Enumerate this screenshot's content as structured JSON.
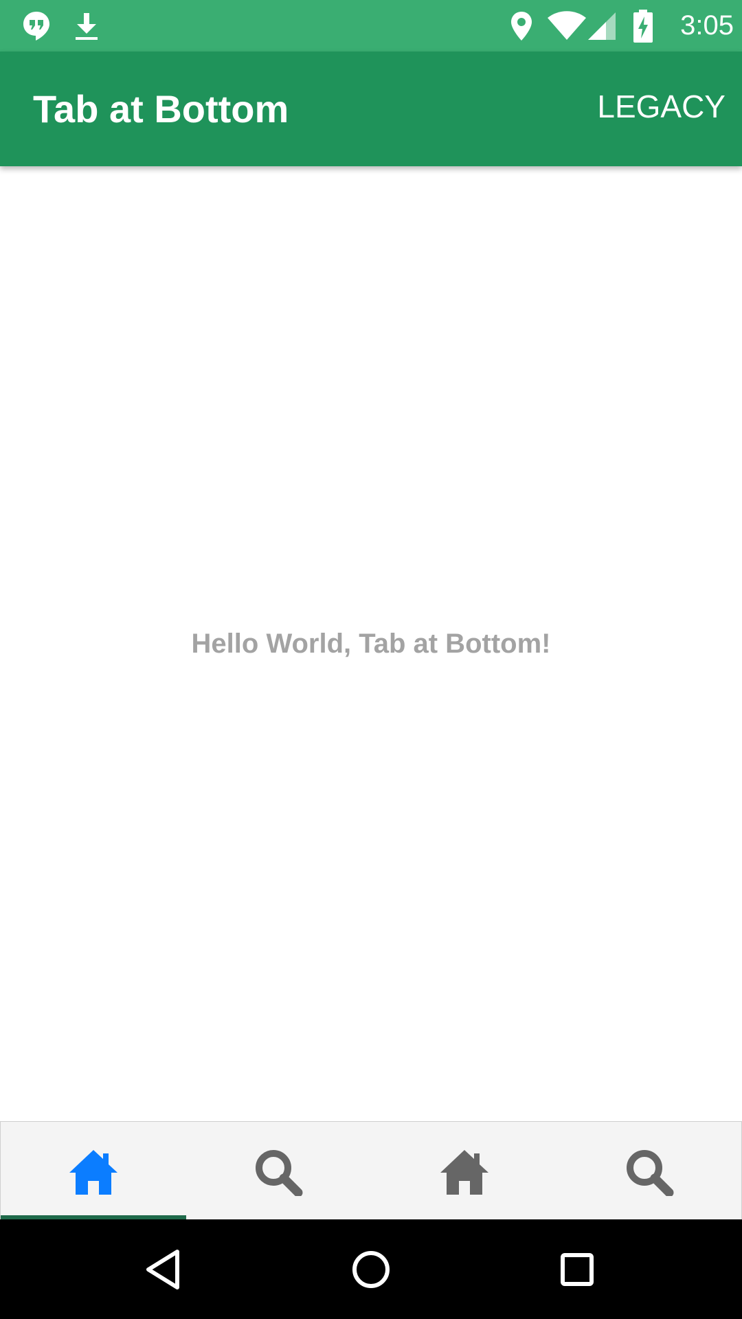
{
  "status_bar": {
    "time": "3:05",
    "icons": [
      "hangouts-icon",
      "download-icon",
      "location-icon",
      "wifi-icon",
      "signal-icon",
      "battery-charging-icon"
    ],
    "color": "#3aae72"
  },
  "app_bar": {
    "title": "Tab at Bottom",
    "action_label": "LEGACY",
    "color": "#1f935a"
  },
  "main": {
    "message": "Hello World, Tab at Bottom!"
  },
  "tab_bar": {
    "tabs": [
      {
        "icon": "home-icon",
        "selected": true,
        "color": "#0b7dff"
      },
      {
        "icon": "search-icon",
        "selected": false,
        "color": "#666666"
      },
      {
        "icon": "home-icon",
        "selected": false,
        "color": "#666666"
      },
      {
        "icon": "search-icon",
        "selected": false,
        "color": "#666666"
      }
    ],
    "indicator_color": "#1f6a4a"
  },
  "nav_bar": {
    "buttons": [
      "back-icon",
      "home-circle-icon",
      "recents-icon"
    ]
  }
}
